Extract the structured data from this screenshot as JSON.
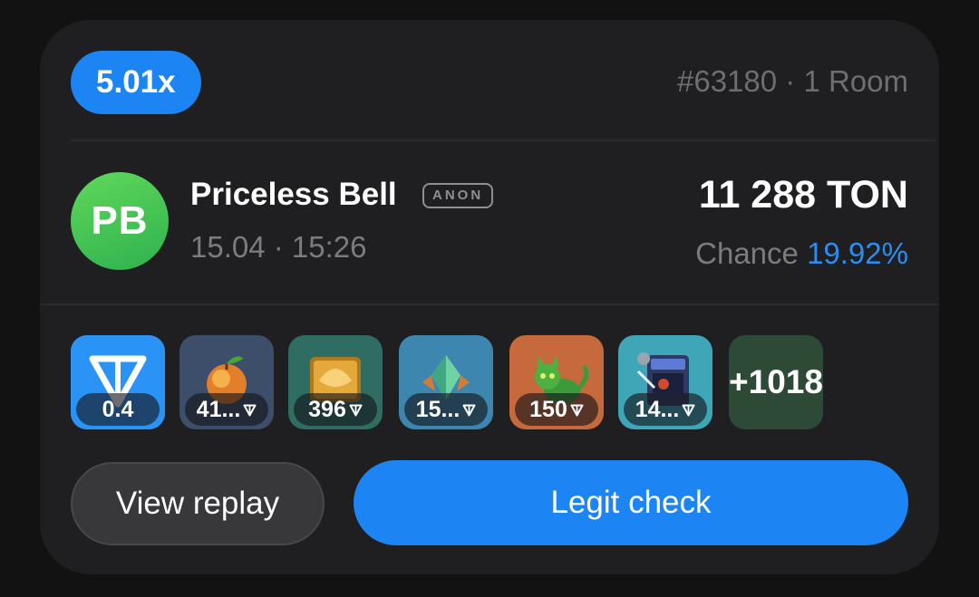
{
  "header": {
    "multiplier": "5.01x",
    "game_meta": "#63180 · 1 Room"
  },
  "player": {
    "initials": "PB",
    "name": "Priceless Bell",
    "badge": "ANON",
    "timestamp": "15.04 · 15:26",
    "avatar_color": "#3cc24f"
  },
  "result": {
    "amount": "11 288 TON",
    "chance_label": "Chance",
    "chance_value": "19.92%"
  },
  "items": [
    {
      "label": "0.4",
      "icon": "ton-diamond-icon",
      "ton_suffix": false
    },
    {
      "label": "41...",
      "icon": "peach-icon",
      "ton_suffix": true
    },
    {
      "label": "396",
      "icon": "golden-cube-icon",
      "ton_suffix": true
    },
    {
      "label": "15...",
      "icon": "crystal-icon",
      "ton_suffix": true
    },
    {
      "label": "150",
      "icon": "green-cat-icon",
      "ton_suffix": true
    },
    {
      "label": "14...",
      "icon": "arcade-machine-icon",
      "ton_suffix": true
    }
  ],
  "more_items": "+1018",
  "buttons": {
    "replay": "View replay",
    "legit_check": "Legit check"
  },
  "colors": {
    "accent": "#1d84f4",
    "card_bg": "#1f1f21",
    "chance_value": "#2d8cf0"
  }
}
